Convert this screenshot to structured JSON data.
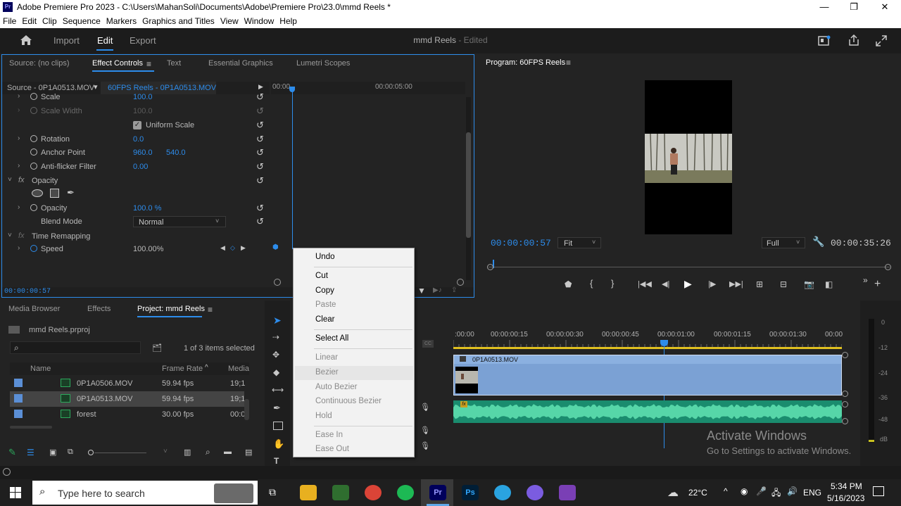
{
  "titlebar": {
    "app_icon": "Pr",
    "title": "Adobe Premiere Pro 2023 - C:\\Users\\MahanSoli\\Documents\\Adobe\\Premiere Pro\\23.0\\mmd Reels *",
    "minimize": "—",
    "restore": "❐",
    "close": "✕"
  },
  "menu": [
    "File",
    "Edit",
    "Clip",
    "Sequence",
    "Markers",
    "Graphics and Titles",
    "View",
    "Window",
    "Help"
  ],
  "workspace": {
    "tabs": [
      "Import",
      "Edit",
      "Export"
    ],
    "active": "Edit",
    "project_name": "mmd Reels",
    "status": "- Edited"
  },
  "effect_controls": {
    "tabs": [
      "Source: (no clips)",
      "Effect Controls",
      "Text",
      "Essential Graphics",
      "Lumetri Scopes"
    ],
    "source_label": "Source - 0P1A0513.MOV",
    "sequence_label": "60FPS Reels - 0P1A0513.MOV",
    "ruler_start": "00:00",
    "ruler_mid": "00:00:05:00",
    "properties": [
      {
        "label": "Scale",
        "value": "100.0"
      },
      {
        "label": "Scale Width",
        "value": "100.0"
      },
      {
        "label": "Uniform Scale",
        "value": ""
      },
      {
        "label": "Rotation",
        "value": "0.0"
      },
      {
        "label": "Anchor Point",
        "value": "960.0",
        "value2": "540.0"
      },
      {
        "label": "Anti-flicker Filter",
        "value": "0.00"
      },
      {
        "label": "Opacity",
        "value": ""
      },
      {
        "label": "Opacity",
        "value": "100.0 %"
      },
      {
        "label": "Blend Mode",
        "value": "Normal"
      },
      {
        "label": "Time Remapping",
        "value": ""
      },
      {
        "label": "Speed",
        "value": "100.00%"
      }
    ],
    "fx_label": "fx",
    "timecode": "00:00:00:57"
  },
  "program_monitor": {
    "title": "Program: 60FPS Reels",
    "timecode": "00:00:00:57",
    "fit": "Fit",
    "quality": "Full",
    "duration": "00:00:35:26"
  },
  "project_panel": {
    "tabs": [
      "Media Browser",
      "Effects",
      "Project: mmd Reels"
    ],
    "project_file": "mmd Reels.prproj",
    "items_selected": "1 of 3 items selected",
    "columns": [
      "Name",
      "Frame Rate",
      "Media"
    ],
    "rows": [
      {
        "name": "0P1A0506.MOV",
        "fps": "59.94 fps",
        "media": "19;1"
      },
      {
        "name": "0P1A0513.MOV",
        "fps": "59.94 fps",
        "media": "19;1"
      },
      {
        "name": "forest",
        "fps": "30.00 fps",
        "media": "00:0"
      }
    ]
  },
  "timeline": {
    "ruler": [
      ":00:00",
      "00:00:00:15",
      "00:00:00:30",
      "00:00:00:45",
      "00:00:01:00",
      "00:00:01:15",
      "00:00:01:30",
      "00:00"
    ],
    "clip_name": "0P1A0513.MOV",
    "fx_badge": "fx",
    "cc": "CC"
  },
  "audio_meter": {
    "labels": [
      "0",
      "-12",
      "-24",
      "-36",
      "-48",
      "dB"
    ]
  },
  "context_menu": {
    "items": [
      "Undo",
      "Cut",
      "Copy",
      "Paste",
      "Clear",
      "Select All",
      "Linear",
      "Bezier",
      "Auto Bezier",
      "Continuous Bezier",
      "Hold",
      "Ease In",
      "Ease Out"
    ],
    "highlighted": "Bezier"
  },
  "watermark": {
    "title": "Activate Windows",
    "subtitle": "Go to Settings to activate Windows."
  },
  "taskbar": {
    "search_placeholder": "Type here to search",
    "apps": [
      "Pr",
      "Ps"
    ],
    "temperature": "22°C",
    "language": "ENG",
    "time": "5:34 PM",
    "date": "5/16/2023"
  }
}
